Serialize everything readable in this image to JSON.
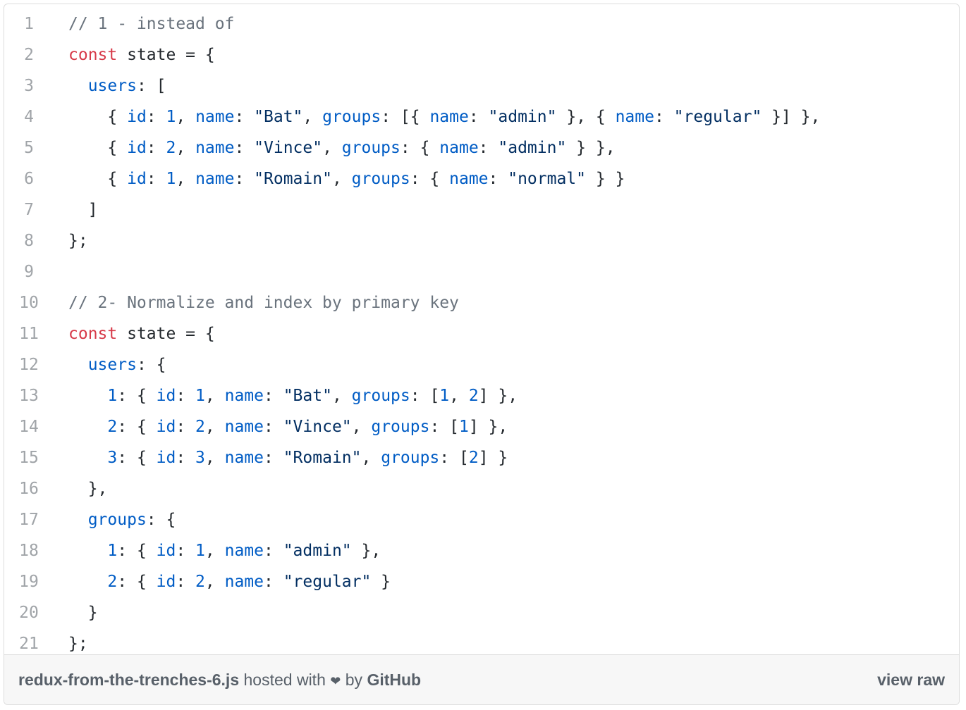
{
  "file": {
    "name": "redux-from-the-trenches-6.js",
    "hosted_text": "hosted with",
    "by_text": "by",
    "host": "GitHub",
    "view_raw": "view raw"
  },
  "code_lines": [
    "// 1 - instead of",
    "const state = {",
    "  users: [",
    "    { id: 1, name: \"Bat\", groups: [{ name: \"admin\" }, { name: \"regular\" }] },",
    "    { id: 2, name: \"Vince\", groups: { name: \"admin\" } },",
    "    { id: 1, name: \"Romain\", groups: { name: \"normal\" } }",
    "  ]",
    "};",
    "",
    "// 2- Normalize and index by primary key",
    "const state = {",
    "  users: {",
    "    1: { id: 1, name: \"Bat\", groups: [1, 2] },",
    "    2: { id: 2, name: \"Vince\", groups: [1] },",
    "    3: { id: 3, name: \"Romain\", groups: [2] }",
    "  },",
    "  groups: {",
    "    1: { id: 1, name: \"admin\" },",
    "    2: { id: 2, name: \"regular\" }",
    "  }",
    "};"
  ]
}
